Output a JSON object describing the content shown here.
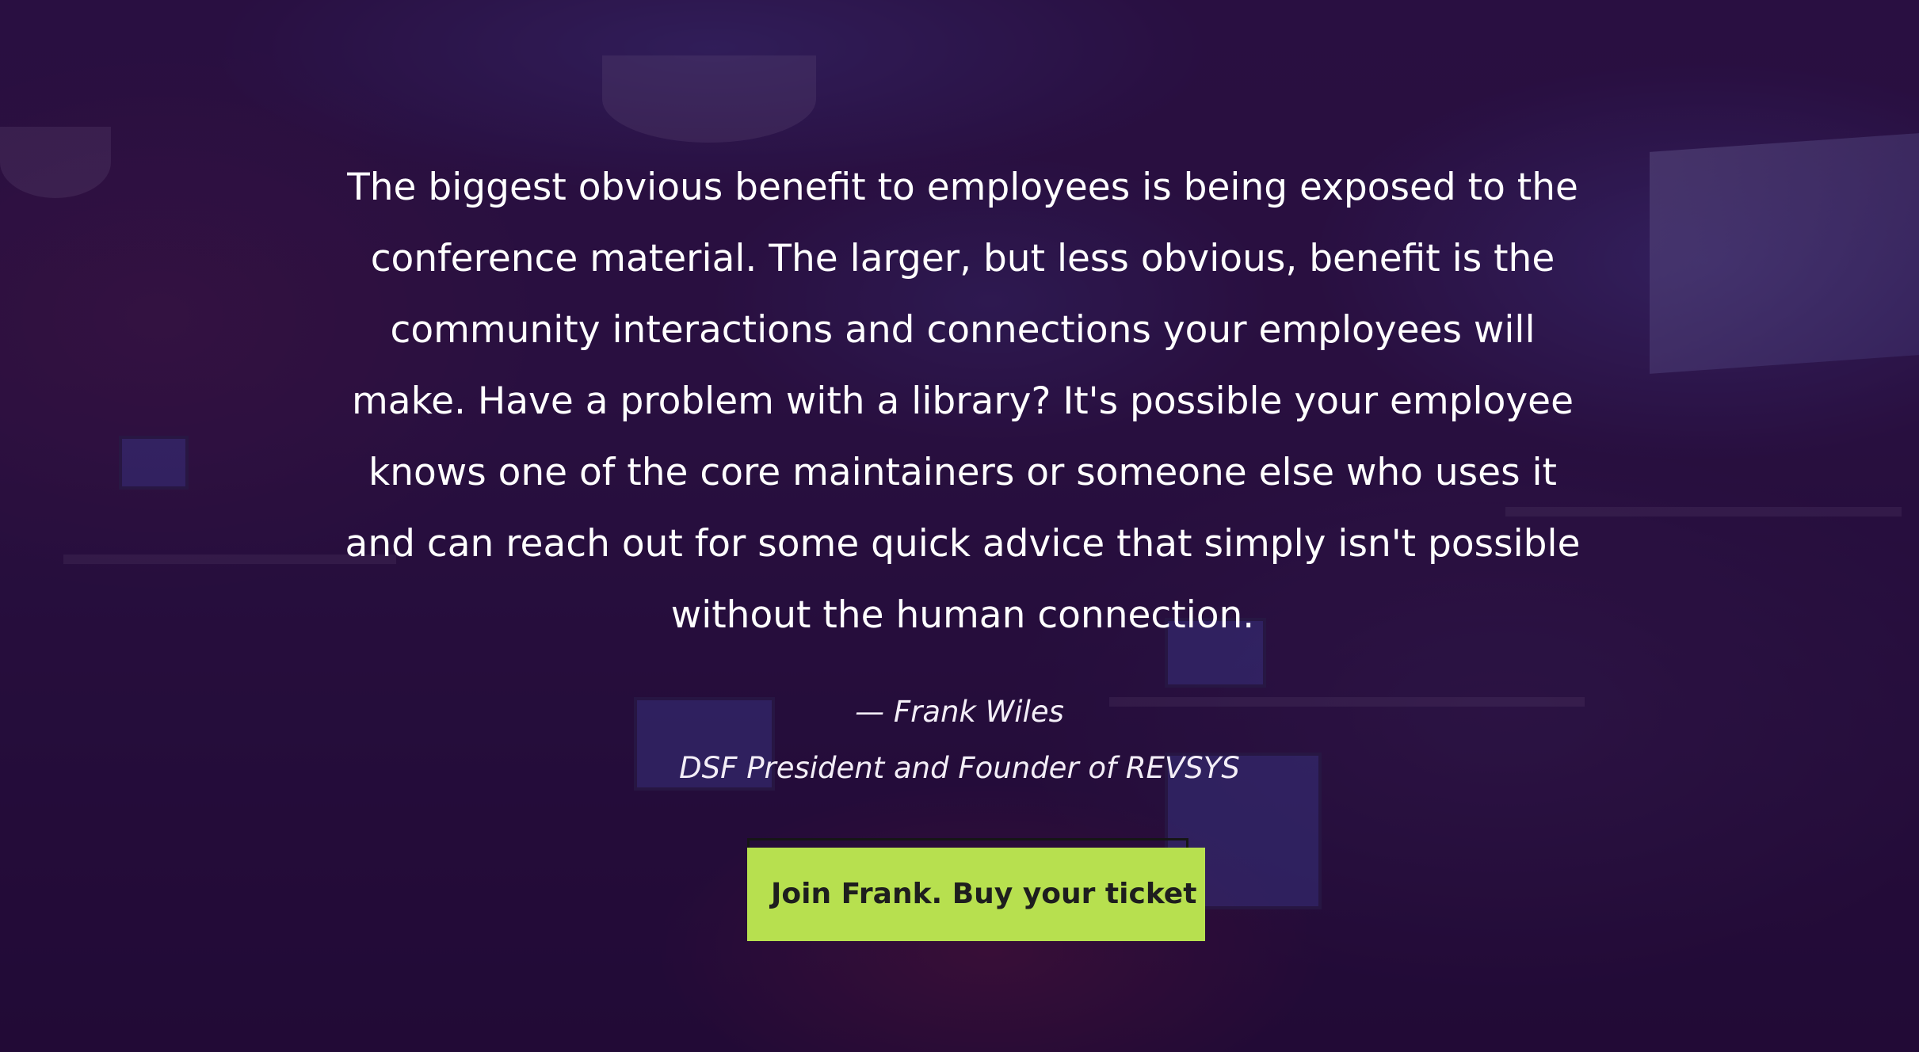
{
  "testimonial": {
    "quote": "The biggest obvious benefit to employees is being exposed to the conference material. The larger, but less obvious, benefit is the community interactions and connections your employees will make. Have a problem with a library? It's possible your employee knows one of the core maintainers or someone else who uses it and can reach out for some quick advice that simply isn't possible without the human connection.",
    "author": "— Frank Wiles",
    "author_title": "DSF President and Founder of REVSYS"
  },
  "cta": {
    "label": "Join Frank. Buy your ticket"
  },
  "colors": {
    "overlay": "#28103f",
    "button_bg": "#b7e04f",
    "button_text": "#1e1e1e",
    "text": "#ffffff"
  }
}
